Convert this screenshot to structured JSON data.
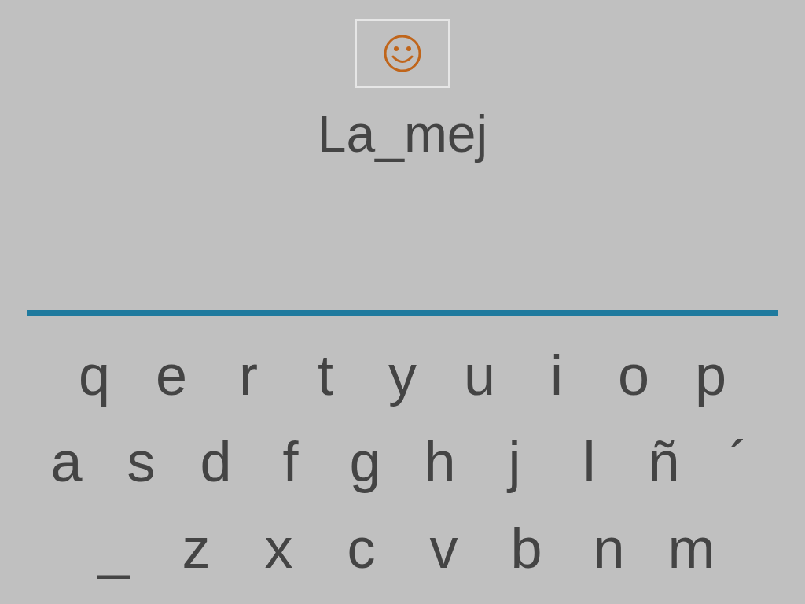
{
  "answer": "La_mej",
  "keyboard_rows": [
    [
      "q",
      "e",
      "r",
      "t",
      "y",
      "u",
      "i",
      "o",
      "p"
    ],
    [
      "a",
      "s",
      "d",
      "f",
      "g",
      "h",
      "j",
      "l",
      "ñ",
      "´"
    ],
    [
      "_",
      "z",
      "x",
      "c",
      "v",
      "b",
      "n",
      "m"
    ]
  ]
}
